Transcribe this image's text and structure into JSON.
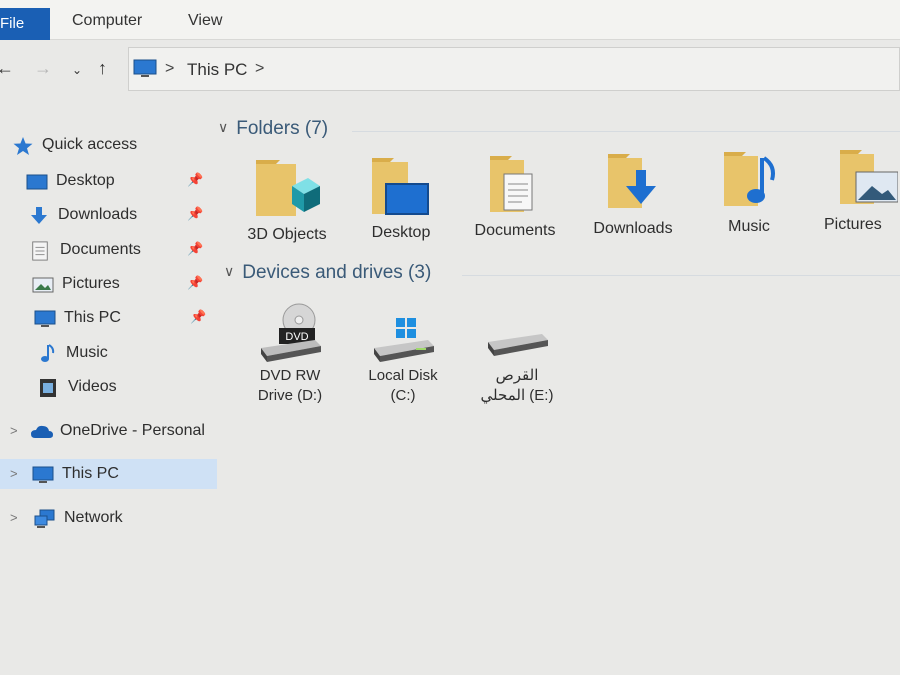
{
  "ribbon": {
    "file": "File",
    "computer": "Computer",
    "view": "View"
  },
  "address": {
    "location": "This PC",
    "separator": ">"
  },
  "sidebar": {
    "quick_access": "Quick access",
    "items": [
      {
        "label": "Desktop",
        "icon": "desktop-icon",
        "pinned": true
      },
      {
        "label": "Downloads",
        "icon": "downloads-icon",
        "pinned": true
      },
      {
        "label": "Documents",
        "icon": "documents-icon",
        "pinned": true
      },
      {
        "label": "Pictures",
        "icon": "pictures-icon",
        "pinned": true
      },
      {
        "label": "This PC",
        "icon": "this-pc-icon",
        "pinned": true
      },
      {
        "label": "Music",
        "icon": "music-icon",
        "pinned": false
      },
      {
        "label": "Videos",
        "icon": "videos-icon",
        "pinned": false
      }
    ],
    "onedrive": "OneDrive - Personal",
    "this_pc": "This PC",
    "network": "Network"
  },
  "folders": {
    "heading": "Folders (7)",
    "items": [
      {
        "label": "3D Objects"
      },
      {
        "label": "Desktop"
      },
      {
        "label": "Documents"
      },
      {
        "label": "Downloads"
      },
      {
        "label": "Music"
      },
      {
        "label": "Pictures"
      }
    ]
  },
  "devices": {
    "heading": "Devices and drives (3)",
    "items": [
      {
        "line1": "DVD RW",
        "line2": "Drive (D:)",
        "badge": "DVD"
      },
      {
        "line1": "Local Disk",
        "line2": "(C:)"
      },
      {
        "line1": "القرص",
        "line2": "المحلي (E:)"
      }
    ]
  },
  "colors": {
    "accent": "#1a5fb4",
    "selection": "#cfe1f5",
    "folder": "#e8c46a",
    "heading": "#3a5a78"
  }
}
